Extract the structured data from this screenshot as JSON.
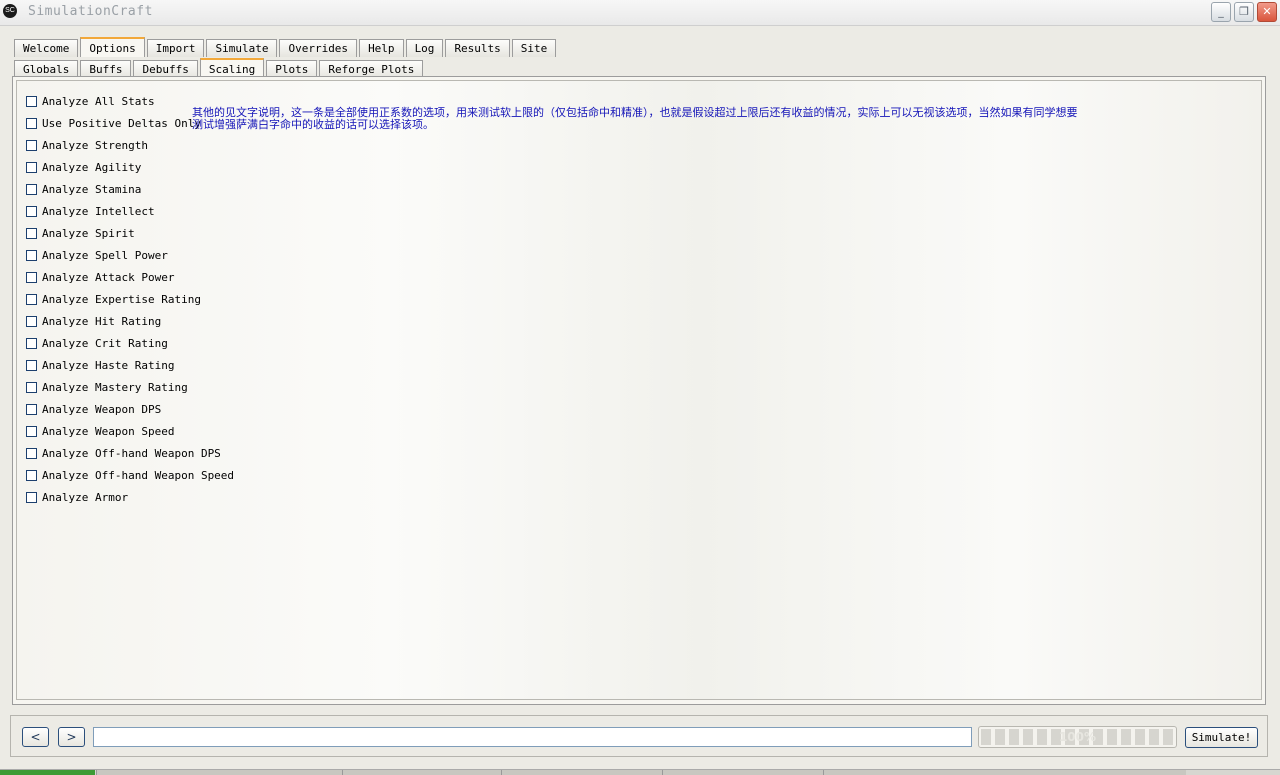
{
  "window": {
    "title": "SimulationCraft",
    "icon_text": "SC",
    "controls": {
      "minimize": "_",
      "restore": "❐",
      "close": "✕"
    }
  },
  "main_tabs": [
    {
      "label": "Welcome",
      "active": false
    },
    {
      "label": "Options",
      "active": true
    },
    {
      "label": "Import",
      "active": false
    },
    {
      "label": "Simulate",
      "active": false
    },
    {
      "label": "Overrides",
      "active": false
    },
    {
      "label": "Help",
      "active": false
    },
    {
      "label": "Log",
      "active": false
    },
    {
      "label": "Results",
      "active": false
    },
    {
      "label": "Site",
      "active": false
    }
  ],
  "sub_tabs": [
    {
      "label": "Globals",
      "active": false
    },
    {
      "label": "Buffs",
      "active": false
    },
    {
      "label": "Debuffs",
      "active": false
    },
    {
      "label": "Scaling",
      "active": true
    },
    {
      "label": "Plots",
      "active": false
    },
    {
      "label": "Reforge Plots",
      "active": false
    }
  ],
  "scaling_options": [
    {
      "label": "Analyze All Stats",
      "checked": false
    },
    {
      "label": "Use Positive Deltas Only",
      "checked": false
    },
    {
      "label": "Analyze Strength",
      "checked": false
    },
    {
      "label": "Analyze Agility",
      "checked": false
    },
    {
      "label": "Analyze Stamina",
      "checked": false
    },
    {
      "label": "Analyze Intellect",
      "checked": false
    },
    {
      "label": "Analyze Spirit",
      "checked": false
    },
    {
      "label": "Analyze Spell Power",
      "checked": false
    },
    {
      "label": "Analyze Attack Power",
      "checked": false
    },
    {
      "label": "Analyze Expertise Rating",
      "checked": false
    },
    {
      "label": "Analyze Hit Rating",
      "checked": false
    },
    {
      "label": "Analyze Crit Rating",
      "checked": false
    },
    {
      "label": "Analyze Haste Rating",
      "checked": false
    },
    {
      "label": "Analyze Mastery Rating",
      "checked": false
    },
    {
      "label": "Analyze Weapon DPS",
      "checked": false
    },
    {
      "label": "Analyze Weapon Speed",
      "checked": false
    },
    {
      "label": "Analyze Off-hand Weapon DPS",
      "checked": false
    },
    {
      "label": "Analyze Off-hand Weapon Speed",
      "checked": false
    },
    {
      "label": "Analyze Armor",
      "checked": false
    }
  ],
  "annotation": {
    "line1": "其他的见文字说明，这一条是全部使用正系数的选项，用来测试软上限的（仅包括命中和精准），也就是假设超过上限后还有收益的情况，实际上可以无视该选项，当然如果有同学想要",
    "line2": "测试增强萨满白字命中的收益的话可以选择该项。",
    "color": "#1515b8"
  },
  "bottom_bar": {
    "back_label": "<",
    "forward_label": ">",
    "address_value": "",
    "progress_text": "100%",
    "progress_value": 1.0,
    "simulate_label": "Simulate!"
  },
  "colors": {
    "active_tab_accent": "#f2a83a",
    "checkbox_border": "#1c3f6e"
  }
}
